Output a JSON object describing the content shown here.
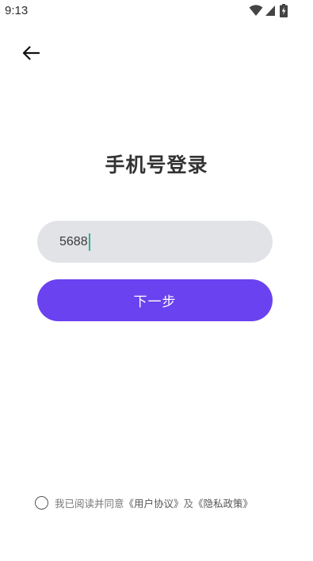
{
  "status_bar": {
    "time": "9:13",
    "icons": [
      "wifi-icon",
      "cellular-signal-icon",
      "battery-charging-icon"
    ]
  },
  "header": {
    "back_icon": "arrow-left-icon"
  },
  "main": {
    "title": "手机号登录",
    "phone_input": {
      "value": "5688"
    },
    "next_button_label": "下一步"
  },
  "agreement": {
    "prefix": "我已阅读并同意",
    "user_agreement": "《用户协议》",
    "conjunction": "及",
    "privacy_policy": "《隐私政策》"
  },
  "colors": {
    "accent": "#6b42f0",
    "input_bg": "#e1e3e7",
    "caret": "#2bb39a"
  }
}
